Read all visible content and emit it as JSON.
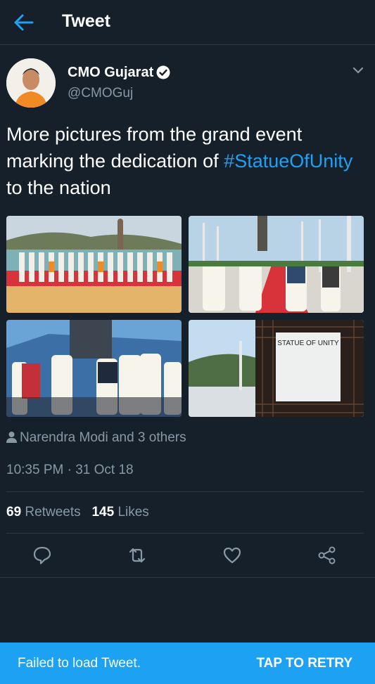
{
  "header": {
    "title": "Tweet",
    "back_icon": "arrow-left-icon"
  },
  "tweet": {
    "author_name": "CMO Gujarat",
    "author_handle": "@CMOGuj",
    "verified_icon": "verified-badge-icon",
    "text_before": "More pictures from the grand event marking the dedication of ",
    "hashtag": "#StatueOfUnity",
    "text_after": " to the nation",
    "photo_sign_title": "STATUE OF UNITY",
    "tagged": "Narendra Modi and 3 others",
    "timestamp": "10:35 PM · 31 Oct 18",
    "retweets_count": "69",
    "retweets_label": "Retweets",
    "likes_count": "145",
    "likes_label": "Likes"
  },
  "actions": [
    "reply-icon",
    "retweet-icon",
    "like-icon",
    "share-icon"
  ],
  "snackbar": {
    "message": "Failed to load Tweet.",
    "action": "TAP TO RETRY"
  },
  "colors": {
    "background": "#15202b",
    "accent": "#1da1f2",
    "muted": "#8899a6"
  }
}
